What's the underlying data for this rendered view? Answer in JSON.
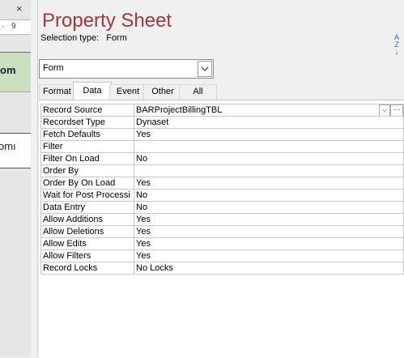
{
  "left": {
    "close_glyph": "×",
    "ruler_marks": [
      "·",
      "9"
    ],
    "band1_text": "om",
    "band2_text": "omı"
  },
  "property_sheet": {
    "title": "Property Sheet",
    "selection_label": "Selection type:",
    "selection_value": "Form",
    "sort_icon_text": "A\nZ",
    "object_combo_value": "Form",
    "tabs": [
      {
        "label": "Format"
      },
      {
        "label": "Data"
      },
      {
        "label": "Event"
      },
      {
        "label": "Other"
      },
      {
        "label": "All"
      }
    ],
    "active_tab": "Data",
    "properties": [
      {
        "name": "Record Source",
        "value": "BARProjectBillingTBL"
      },
      {
        "name": "Recordset Type",
        "value": "Dynaset"
      },
      {
        "name": "Fetch Defaults",
        "value": "Yes"
      },
      {
        "name": "Filter",
        "value": ""
      },
      {
        "name": "Filter On Load",
        "value": "No"
      },
      {
        "name": "Order By",
        "value": ""
      },
      {
        "name": "Order By On Load",
        "value": "Yes"
      },
      {
        "name": "Wait for Post Processi",
        "value": "No"
      },
      {
        "name": "Data Entry",
        "value": "No"
      },
      {
        "name": "Allow Additions",
        "value": "Yes"
      },
      {
        "name": "Allow Deletions",
        "value": "Yes"
      },
      {
        "name": "Allow Edits",
        "value": "Yes"
      },
      {
        "name": "Allow Filters",
        "value": "Yes"
      },
      {
        "name": "Record Locks",
        "value": "No Locks"
      }
    ]
  }
}
